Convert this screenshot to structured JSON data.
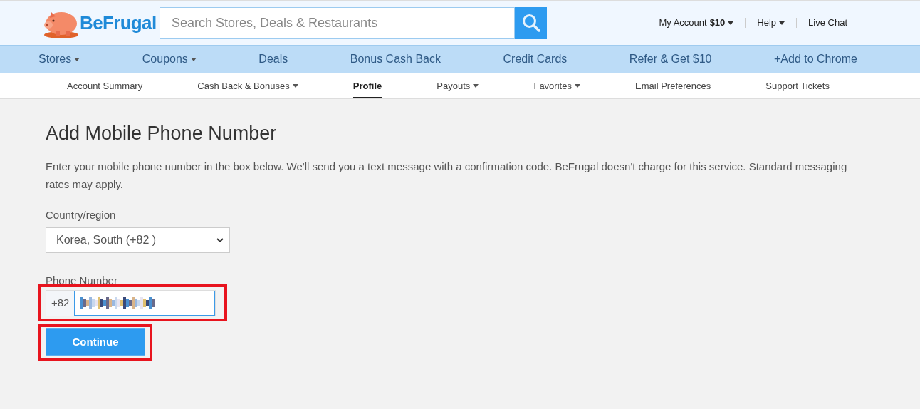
{
  "header": {
    "logo": "BeFrugal",
    "search": {
      "placeholder": "Search Stores, Deals & Restaurants"
    },
    "links": [
      {
        "label": "My Account",
        "amount": "$10",
        "dropdown": true
      },
      {
        "label": "Help",
        "dropdown": true
      },
      {
        "label": "Live Chat",
        "dropdown": false
      }
    ]
  },
  "nav": [
    {
      "label": "Stores",
      "dropdown": true
    },
    {
      "label": "Coupons",
      "dropdown": true
    },
    {
      "label": "Deals",
      "dropdown": false
    },
    {
      "label": "Bonus Cash Back",
      "dropdown": false
    },
    {
      "label": "Credit Cards",
      "dropdown": false
    },
    {
      "label": "Refer & Get $10",
      "dropdown": false
    },
    {
      "label": "+Add to Chrome",
      "dropdown": false
    }
  ],
  "subnav": [
    {
      "label": "Account Summary",
      "dropdown": false,
      "selected": false
    },
    {
      "label": "Cash Back & Bonuses",
      "dropdown": true,
      "selected": false
    },
    {
      "label": "Profile",
      "dropdown": false,
      "selected": true
    },
    {
      "label": "Payouts",
      "dropdown": true,
      "selected": false
    },
    {
      "label": "Favorites",
      "dropdown": true,
      "selected": false
    },
    {
      "label": "Email Preferences",
      "dropdown": false,
      "selected": false
    },
    {
      "label": "Support Tickets",
      "dropdown": false,
      "selected": false
    }
  ],
  "form": {
    "title": "Add Mobile Phone Number",
    "intro": "Enter your mobile phone number in the box below. We'll send you a text message with a confirmation code. BeFrugal doesn't charge for this service. Standard messaging rates may apply.",
    "country_label": "Country/region",
    "country_value": "Korea, South (+82 )",
    "phone_label": "Phone Number",
    "phone_prefix": "+82",
    "submit": "Continue"
  }
}
